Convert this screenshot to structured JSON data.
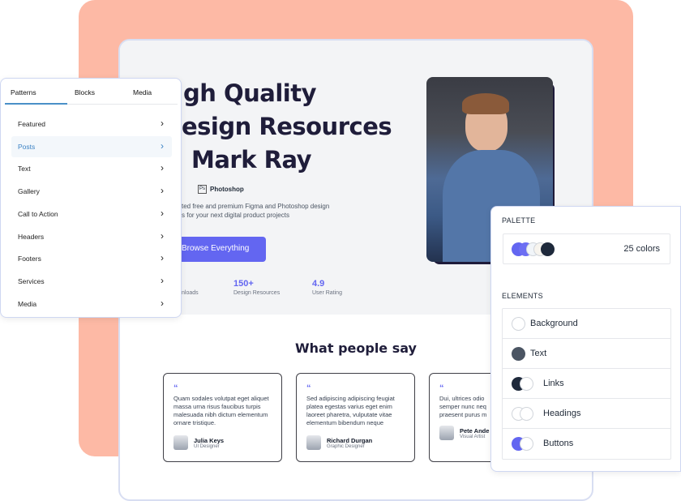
{
  "hero": {
    "title_lines": [
      "gh Quality",
      "esign Resources",
      "Mark Ray"
    ],
    "tool": "Photoshop",
    "tool_icon": "Ps",
    "description_lines": [
      "ted free and premium Figma and Photoshop design",
      "s for your next digital product projects"
    ],
    "cta": "Browse Everything",
    "stats": [
      {
        "value": "",
        "label": "nloads"
      },
      {
        "value": "150+",
        "label": "Design Resources"
      },
      {
        "value": "4.9",
        "label": "User Rating"
      }
    ]
  },
  "testimonials": {
    "heading": "What people say",
    "quote_mark": "“",
    "items": [
      {
        "text": "Quam sodales volutpat eget aliquet massa urna risus faucibus turpis malesuada nibh dictum elementum ornare tristique.",
        "name": "Julia Keys",
        "role": "UI Designer"
      },
      {
        "text": "Sed adipiscing adipiscing feugiat platea egestas varius eget enim laoreet pharetra, vulputate vitae elementum bibendum neque",
        "name": "Richard Durgan",
        "role": "Graphic Designer"
      },
      {
        "text": "Dui, ultrices odio semper nunc neq praesent purus m",
        "name": "Pete Ande",
        "role": "Visual Artist"
      }
    ]
  },
  "inserter": {
    "tabs": [
      "Patterns",
      "Blocks",
      "Media"
    ],
    "active_tab": "Patterns",
    "items": [
      "Featured",
      "Posts",
      "Text",
      "Gallery",
      "Call to Action",
      "Headers",
      "Footers",
      "Services",
      "Media"
    ],
    "active_item": "Posts"
  },
  "styles": {
    "palette_label": "PALETTE",
    "palette_count": "25 colors",
    "palette_colors": [
      "#6366f1",
      "#6d6ff3",
      "#f1f5f9",
      "#f7f4ee",
      "#1e293b"
    ],
    "elements_label": "ELEMENTS",
    "elements": [
      "Background",
      "Text",
      "Links",
      "Headings",
      "Buttons"
    ]
  },
  "colors": {
    "accent": "#6366f1",
    "peach": "#fdb9a5",
    "dark": "#1f1d3a"
  }
}
